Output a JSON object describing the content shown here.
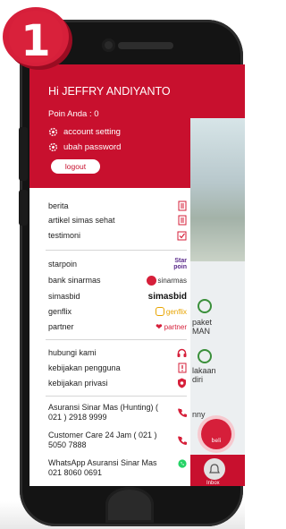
{
  "badge": {
    "number": "1"
  },
  "drawer": {
    "greeting": "Hi JEFFRY ANDIYANTO",
    "poin": "Poin Anda :  0",
    "account_setting": "account setting",
    "ubah_password": "ubah password",
    "logout": "logout"
  },
  "menu_info": [
    {
      "label": "berita",
      "icon": "document-icon"
    },
    {
      "label": "artikel simas sehat",
      "icon": "document-icon"
    },
    {
      "label": "testimoni",
      "icon": "checkbox-icon"
    }
  ],
  "menu_partners": [
    {
      "label": "starpoin",
      "logo": "Star\npoin"
    },
    {
      "label": "bank sinarmas",
      "logo": "sinarmas"
    },
    {
      "label": "simasbid",
      "logo": "simasbid"
    },
    {
      "label": "genflix",
      "logo": "genflix"
    },
    {
      "label": "partner",
      "logo": "partner"
    }
  ],
  "menu_help": [
    {
      "label": "hubungi kami",
      "icon": "headset-icon"
    },
    {
      "label": "kebijakan pengguna",
      "icon": "alert-document-icon"
    },
    {
      "label": "kebijakan privasi",
      "icon": "shield-icon"
    }
  ],
  "contacts": [
    {
      "text": "Asuransi Sinar Mas (Hunting) ( 021 ) 2918 9999",
      "icon": "phone-icon"
    },
    {
      "text": "Customer Care 24 Jam ( 021 ) 5050 7888",
      "icon": "phone-icon"
    },
    {
      "text": "WhatsApp Asuransi Sinar Mas 021 8060 0691",
      "icon": "whatsapp-icon"
    }
  ],
  "background": {
    "text1": "paket",
    "text2": "MAN",
    "text3": "lakaan",
    "text4": "diri",
    "text5": "nny",
    "fab_label": "beli",
    "inbox_label": "Inbox"
  },
  "colors": {
    "brand_red": "#c8102e",
    "whatsapp_green": "#25d366"
  }
}
